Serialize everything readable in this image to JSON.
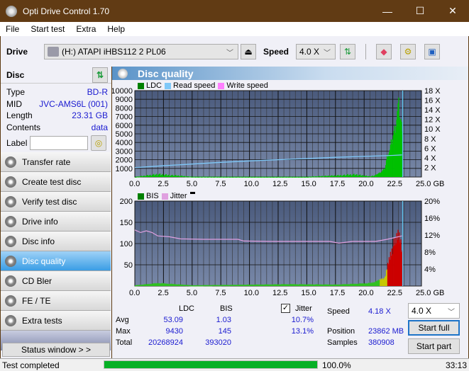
{
  "window": {
    "title": "Opti Drive Control 1.70",
    "minimize": "—",
    "maximize": "☐",
    "close": "✕"
  },
  "menu": [
    "File",
    "Start test",
    "Extra",
    "Help"
  ],
  "toolbar": {
    "drive_label": "Drive",
    "drive_value": "(H:)  ATAPI iHBS112   2 PL06",
    "speed_label": "Speed",
    "speed_value": "4.0 X"
  },
  "disc": {
    "header": "Disc",
    "rows": [
      {
        "k": "Type",
        "v": "BD-R"
      },
      {
        "k": "MID",
        "v": "JVC-AMS6L (001)"
      },
      {
        "k": "Length",
        "v": "23.31 GB"
      },
      {
        "k": "Contents",
        "v": "data"
      }
    ],
    "label_label": "Label",
    "label_value": ""
  },
  "nav": [
    "Transfer rate",
    "Create test disc",
    "Verify test disc",
    "Drive info",
    "Disc info",
    "Disc quality",
    "CD Bler",
    "FE / TE",
    "Extra tests"
  ],
  "nav_active": "Disc quality",
  "status_window_btn": "Status window > >",
  "panel_title": "Disc quality",
  "chart_data": [
    {
      "type": "bar",
      "title": "LDC / Read speed",
      "legend": [
        "LDC",
        "Read speed",
        "Write speed"
      ],
      "legend_colors": [
        "#008000",
        "#7fc8f8",
        "#ff80ff"
      ],
      "x_ticks": [
        "0.0",
        "2.5",
        "5.0",
        "7.5",
        "10.0",
        "12.5",
        "15.0",
        "17.5",
        "20.0",
        "22.5",
        "25.0 GB"
      ],
      "xlim": [
        0,
        25
      ],
      "y_ticks": [
        "10000",
        "9000",
        "8000",
        "7000",
        "6000",
        "5000",
        "4000",
        "3000",
        "2000",
        "1000"
      ],
      "ylim": [
        0,
        10000
      ],
      "y2_ticks": [
        "18 X",
        "16 X",
        "14 X",
        "12 X",
        "10 X",
        "8 X",
        "6 X",
        "4 X",
        "2 X"
      ],
      "y2lim": [
        0,
        18
      ],
      "ldc": [
        [
          0,
          20
        ],
        [
          2,
          450
        ],
        [
          5,
          40
        ],
        [
          10,
          30
        ],
        [
          15,
          30
        ],
        [
          19.2,
          400
        ],
        [
          20.5,
          100
        ],
        [
          21,
          300
        ],
        [
          21.5,
          700
        ],
        [
          21.8,
          1200
        ],
        [
          22,
          3000
        ],
        [
          22.2,
          3500
        ],
        [
          22.4,
          5000
        ],
        [
          22.6,
          6000
        ],
        [
          22.8,
          7800
        ],
        [
          22.9,
          9000
        ],
        [
          23.0,
          9430
        ],
        [
          23.1,
          8000
        ],
        [
          23.2,
          7500
        ],
        [
          23.3,
          5000
        ],
        [
          23.31,
          0
        ]
      ],
      "read_speed": [
        [
          0,
          1.95
        ],
        [
          2.5,
          2.35
        ],
        [
          5,
          2.7
        ],
        [
          7.5,
          3.05
        ],
        [
          10,
          3.35
        ],
        [
          12.5,
          3.6
        ],
        [
          15,
          3.85
        ],
        [
          17.5,
          4.1
        ],
        [
          20,
          4.3
        ],
        [
          22.5,
          4.5
        ],
        [
          23.3,
          4.6
        ]
      ]
    },
    {
      "type": "bar",
      "title": "BIS / Jitter",
      "legend": [
        "BIS",
        "Jitter"
      ],
      "legend_colors": [
        "#008000",
        "#e0a0e0"
      ],
      "x_ticks": [
        "0.0",
        "2.5",
        "5.0",
        "7.5",
        "10.0",
        "12.5",
        "15.0",
        "17.5",
        "20.0",
        "22.5",
        "25.0 GB"
      ],
      "xlim": [
        0,
        25
      ],
      "y_ticks": [
        "200",
        "150",
        "100",
        "50"
      ],
      "ylim": [
        0,
        200
      ],
      "y2_ticks": [
        "20%",
        "16%",
        "12%",
        "8%",
        "4%"
      ],
      "y2lim": [
        0,
        20
      ],
      "bis": [
        [
          0,
          2
        ],
        [
          2,
          8
        ],
        [
          5,
          2
        ],
        [
          13.5,
          5
        ],
        [
          17.5,
          4
        ],
        [
          19.2,
          6
        ],
        [
          20.5,
          8
        ],
        [
          21,
          12
        ],
        [
          21.5,
          20
        ],
        [
          21.8,
          22
        ],
        [
          22,
          55
        ],
        [
          22.3,
          95
        ],
        [
          22.5,
          110
        ],
        [
          22.7,
          120
        ],
        [
          22.9,
          145
        ],
        [
          23.1,
          140
        ],
        [
          23.3,
          95
        ],
        [
          23.31,
          0
        ]
      ],
      "jitter": [
        [
          0,
          13.2
        ],
        [
          0.5,
          12.6
        ],
        [
          1,
          13.0
        ],
        [
          1.5,
          12.6
        ],
        [
          2,
          11.8
        ],
        [
          3,
          11.6
        ],
        [
          4,
          11.1
        ],
        [
          6,
          11.0
        ],
        [
          9,
          11.0
        ],
        [
          9.5,
          10.6
        ],
        [
          12,
          10.5
        ],
        [
          17,
          10.5
        ],
        [
          17.8,
          10.1
        ],
        [
          19,
          10.5
        ],
        [
          21,
          10.5
        ],
        [
          22,
          11.0
        ],
        [
          23.3,
          11.8
        ]
      ]
    }
  ],
  "stats": {
    "col_ldc": "LDC",
    "col_bis": "BIS",
    "jitter_label": "Jitter",
    "jitter_checked": true,
    "rows": [
      {
        "k": "Avg",
        "ldc": "53.09",
        "bis": "1.03",
        "jit": "10.7%"
      },
      {
        "k": "Max",
        "ldc": "9430",
        "bis": "145",
        "jit": "13.1%"
      },
      {
        "k": "Total",
        "ldc": "20268924",
        "bis": "393020",
        "jit": ""
      }
    ],
    "speed_label": "Speed",
    "speed_value": "4.18 X",
    "position_label": "Position",
    "position_value": "23862 MB",
    "samples_label": "Samples",
    "samples_value": "380908",
    "speed_select": "4.0 X",
    "start_full": "Start full",
    "start_part": "Start part"
  },
  "status": {
    "text": "Test completed",
    "progress": 100.0,
    "progress_label": "100.0%",
    "time": "33:13"
  }
}
